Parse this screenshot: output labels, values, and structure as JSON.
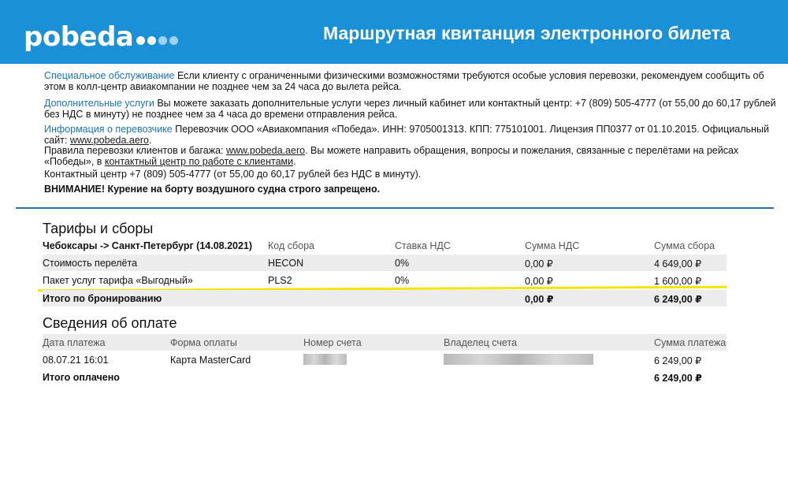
{
  "header": {
    "logo": "pobeda",
    "title": "Маршрутная квитанция электронного билета",
    "dot_colors": [
      "#ffffff",
      "#ffffff",
      "#9fd3f5",
      "#9fd3f5"
    ]
  },
  "info": {
    "special": {
      "lead": "Специальное обслуживание",
      "text": " Если клиенту с ограниченными физическими возможностями требуются особые условия перевозки, рекомендуем сообщить об этом в колл-центр авиакомпании не позднее чем за 24 часа до вылета рейса."
    },
    "extra": {
      "lead": "Дополнительные услуги",
      "text": " Вы можете заказать дополнительные услуги через личный кабинет или контактный центр: +7 (809) 505-4777 (от 55,00 до 60,17 рублей без НДС в минуту) не позднее чем за 4 часа до времени отправления рейса."
    },
    "carrier": {
      "lead": "Информация о перевозчике",
      "text": " Перевозчик ООО «Авиакомпания «Победа». ИНН: 9705001313. КПП: 775101001. Лицензия ПП0377 от 01.10.2015. Официальный сайт: ",
      "link": "www.pobeda.aero",
      "end": "."
    },
    "rules": {
      "text1": "Правила перевозки клиентов и багажа: ",
      "link1": "www.pobeda.aero",
      "text2": ". Вы можете направить обращения, вопросы и пожелания, связанные с перелётами на рейсах «Победы», в ",
      "link2": "контактный центр по работе с клиентами",
      "end": "."
    },
    "contact": "Контактный центр +7 (809) 505-4777 (от 55,00 до 60,17 рублей без НДС в минуту).",
    "warning": "ВНИМАНИЕ! Курение на борту воздушного судна строго запрещено."
  },
  "tariffs": {
    "title": "Тарифы и сборы",
    "headers": [
      "Чебоксары -> Санкт-Петербург (14.08.2021)",
      "Код сбора",
      "Ставка НДС",
      "Сумма НДС",
      "Сумма сбора"
    ],
    "rows": [
      [
        "Стоимость перелёта",
        "HECON",
        "0%",
        "0,00 ₽",
        "4 649,00 ₽"
      ],
      [
        "Пакет услуг тарифа «Выгодный»",
        "PLS2",
        "0%",
        "0,00 ₽",
        "1 600,00 ₽"
      ]
    ],
    "total": [
      "Итого по бронированию",
      "",
      "",
      "0,00 ₽",
      "6 249,00 ₽"
    ]
  },
  "payment": {
    "title": "Сведения об оплате",
    "headers": [
      "Дата платежа",
      "Форма оплаты",
      "Номер счета",
      "Владелец счета",
      "Сумма платежа"
    ],
    "row": [
      "08.07.21 16:01",
      "Карта MasterCard",
      "",
      "",
      "6 249,00 ₽"
    ],
    "total_label": "Итого оплачено",
    "total_amount": "6 249,00 ₽"
  }
}
